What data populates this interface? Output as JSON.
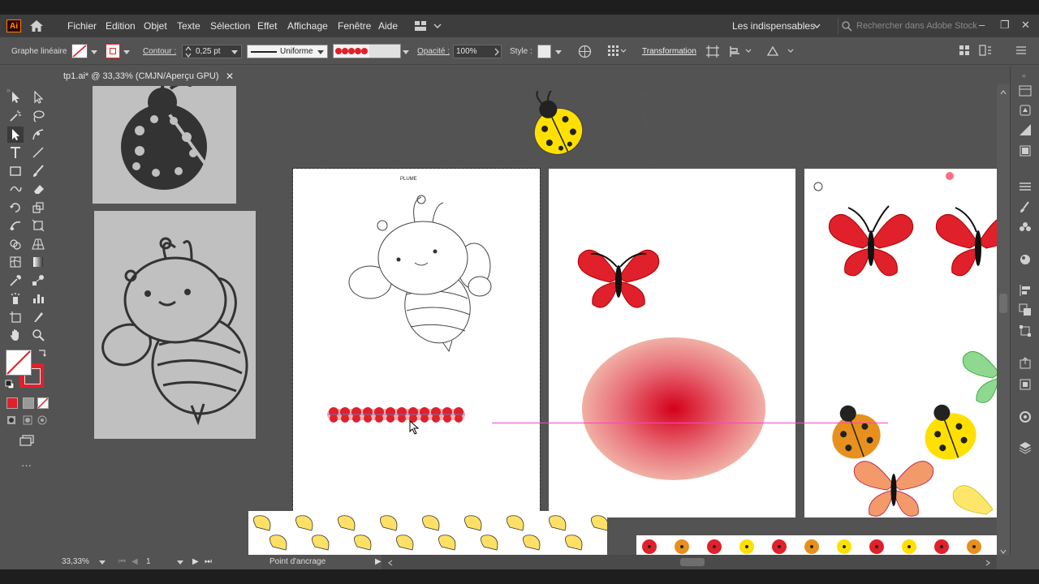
{
  "app": {
    "logo_text": "Ai",
    "menu": [
      "Fichier",
      "Edition",
      "Objet",
      "Texte",
      "Sélection",
      "Effet",
      "Affichage",
      "Fenêtre",
      "Aide"
    ],
    "workspace_label": "Les indispensables",
    "stock_search_placeholder": "Rechercher dans Adobe Stock"
  },
  "control_bar": {
    "selection_type": "Graphe linéaire",
    "stroke_label": "Contour :",
    "stroke_weight": "0,25 pt",
    "profile": "Uniforme",
    "opacity_label": "Opacité :",
    "opacity_value": "100%",
    "style_label": "Style :",
    "transform_label": "Transformation"
  },
  "document": {
    "tab_title": "tp1.ai* @ 33,33% (CMJN/Aperçu GPU)",
    "close_glyph": "✕",
    "artboard1_title": "PLUME"
  },
  "status": {
    "zoom": "33,33%",
    "artboard_number": "1",
    "tool_hint": "Point d'ancrage"
  },
  "colors": {
    "accent_red": "#e0202a",
    "ladybug_yellow": "#ffe000",
    "guide_magenta": "#ff3fd0",
    "butterfly_orange": "#f39a6b",
    "ladybug_orange": "#e8901e"
  },
  "tools": [
    "selection-tool",
    "direct-selection-tool",
    "magic-wand-tool",
    "lasso-tool",
    "pen-tool",
    "curvature-tool",
    "type-tool",
    "line-tool",
    "rectangle-tool",
    "paintbrush-tool",
    "shaper-tool",
    "eraser-tool",
    "rotate-tool",
    "scale-tool",
    "warp-tool",
    "free-transform-tool",
    "shape-builder-tool",
    "perspective-tool",
    "mesh-tool",
    "gradient-tool",
    "eyedropper-tool",
    "blend-tool",
    "symbol-sprayer-tool",
    "graph-tool",
    "artboard-tool",
    "slice-tool",
    "hand-tool",
    "zoom-tool"
  ]
}
